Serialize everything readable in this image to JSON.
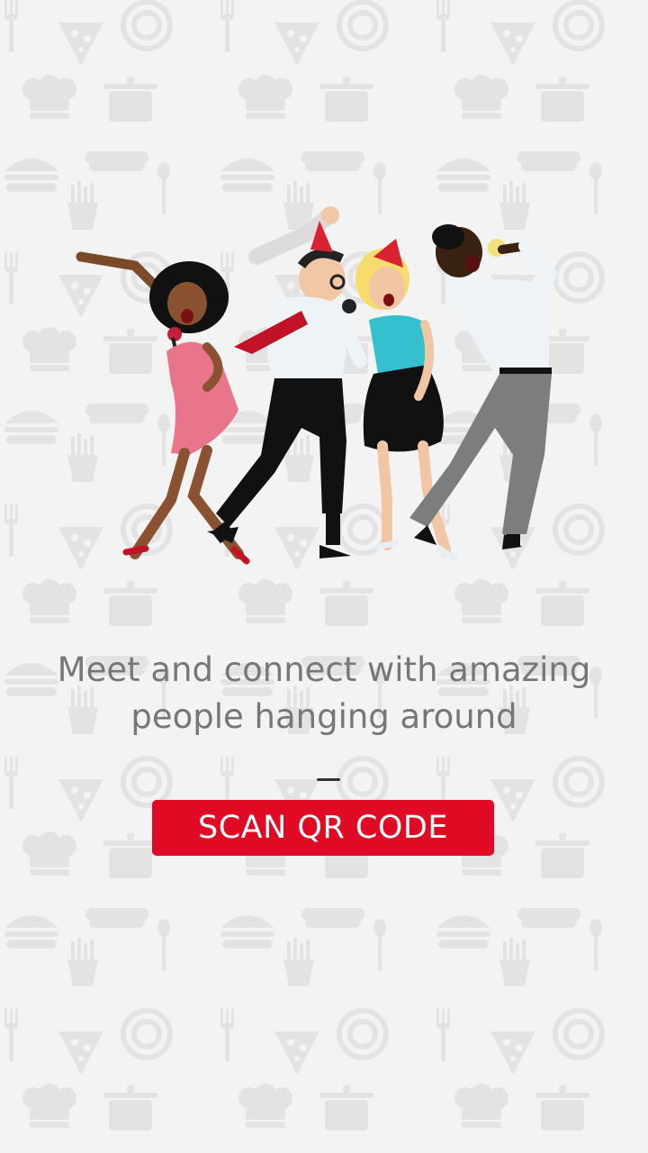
{
  "colors": {
    "background": "#f3f3f3",
    "pattern_icon": "#e4e4e4",
    "headline_text": "#777777",
    "button_bg": "#e00a24",
    "button_text": "#ffffff"
  },
  "illustration": {
    "icon": "dancing-people-karaoke-illustration"
  },
  "headline": {
    "line1": "Meet and connect with amazing",
    "line2": "people hanging around"
  },
  "button": {
    "label": "SCAN QR CODE"
  }
}
